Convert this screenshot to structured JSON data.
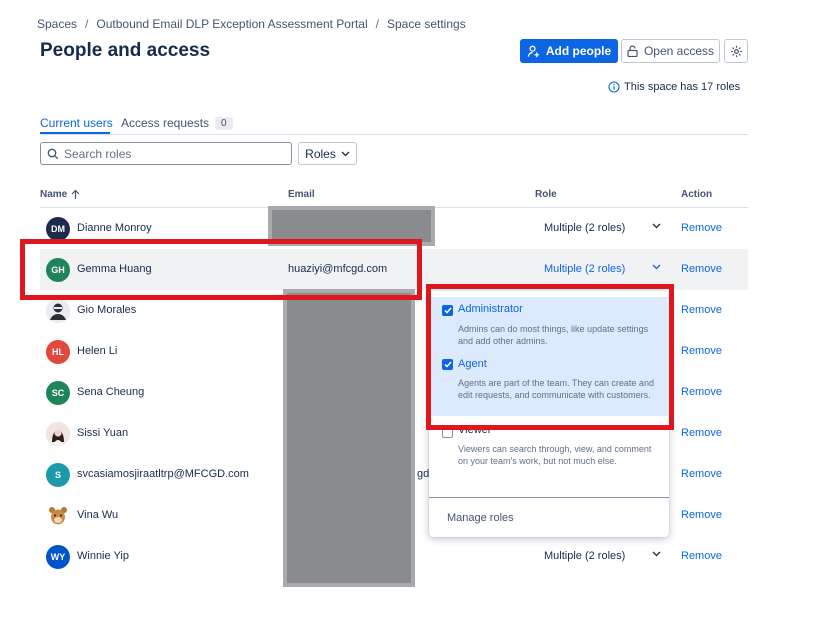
{
  "breadcrumb": {
    "items": [
      "Spaces",
      "Outbound Email DLP Exception Assessment Portal",
      "Space settings"
    ],
    "separator": "/"
  },
  "header": {
    "title": "People and access",
    "add_people_label": "Add people",
    "open_access_label": "Open access",
    "roles_info": "This space has 17 roles"
  },
  "tabs": {
    "current_users": "Current users",
    "access_requests": "Access requests",
    "access_requests_count": "0"
  },
  "filters": {
    "search_placeholder": "Search roles",
    "roles_label": "Roles"
  },
  "table": {
    "headers": {
      "name": "Name",
      "email": "Email",
      "role": "Role",
      "action": "Action"
    },
    "rows": [
      {
        "initials": "DM",
        "name": "Dianne Monroy",
        "email": "",
        "role": "Multiple (2 roles)",
        "action": "Remove",
        "avatar_color": "#1d2b4f"
      },
      {
        "initials": "GH",
        "name": "Gemma Huang",
        "email": "huaziyi@mfcgd.com",
        "role": "Multiple (2 roles)",
        "action": "Remove",
        "avatar_color": "#1f845a"
      },
      {
        "initials": "",
        "name": "Gio Morales",
        "email": "",
        "role": "",
        "action": "Remove",
        "avatar_color": "#dcdfe4"
      },
      {
        "initials": "HL",
        "name": "Helen Li",
        "email": "",
        "role": "",
        "action": "Remove",
        "avatar_color": "#e2483d"
      },
      {
        "initials": "SC",
        "name": "Sena Cheung",
        "email": "",
        "role": "",
        "action": "Remove",
        "avatar_color": "#1f845a"
      },
      {
        "initials": "",
        "name": "Sissi Yuan",
        "email": "",
        "role": "",
        "action": "Remove",
        "avatar_color": "#ead5cf"
      },
      {
        "initials": "S",
        "name": "svcasiamosjiraatltrp@MFCGD.com",
        "email": "gd",
        "role": "",
        "action": "Remove",
        "avatar_color": "#1d9aaa"
      },
      {
        "initials": "",
        "name": "Vina Wu",
        "email": "",
        "role": "",
        "action": "Remove",
        "avatar_color": "#ffffff"
      },
      {
        "initials": "WY",
        "name": "Winnie Yip",
        "email": "",
        "role": "Multiple (2 roles)",
        "action": "Remove",
        "avatar_color": "#0055cc"
      }
    ]
  },
  "role_dropdown": {
    "options": [
      {
        "title": "Administrator",
        "description": "Admins can do most things, like update settings and add other admins.",
        "checked": true
      },
      {
        "title": "Agent",
        "description": "Agents are part of the team. They can create and edit requests, and communicate with customers.",
        "checked": true
      },
      {
        "title": "Viewer",
        "description": "Viewers can search through, view, and comment on your team's work, but not much else.",
        "checked": false
      }
    ],
    "manage_label": "Manage roles"
  },
  "colors": {
    "accent": "#0c66e4",
    "annotation": "#e0161f",
    "redaction": "#8a8b8f"
  }
}
